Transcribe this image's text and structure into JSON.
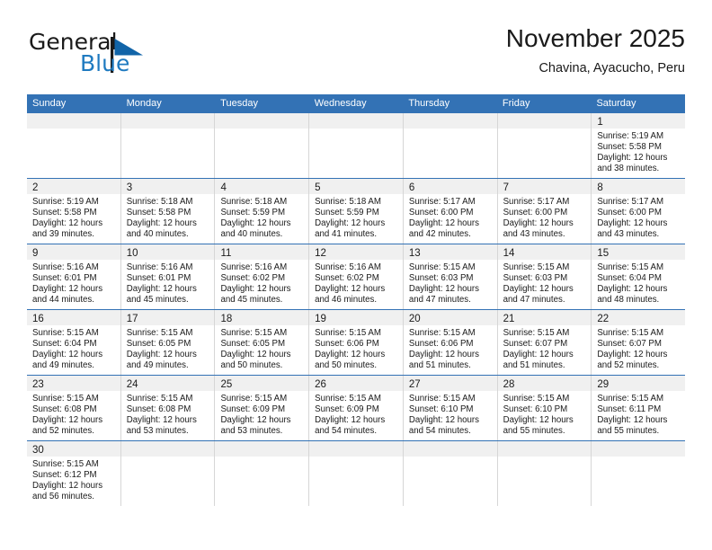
{
  "brand": {
    "name_part1": "General",
    "name_part2": "Blue",
    "logo_icon": "blue-triangle-flag-icon"
  },
  "header": {
    "month_title": "November 2025",
    "location": "Chavina, Ayacucho, Peru"
  },
  "colors": {
    "header_blue": "#3372b5",
    "brand_blue": "#1f7ac0",
    "day_band_gray": "#f0f0f0",
    "cell_divider": "#d6d6d6"
  },
  "weekdays": [
    "Sunday",
    "Monday",
    "Tuesday",
    "Wednesday",
    "Thursday",
    "Friday",
    "Saturday"
  ],
  "weeks": [
    [
      {
        "day": "",
        "lines": []
      },
      {
        "day": "",
        "lines": []
      },
      {
        "day": "",
        "lines": []
      },
      {
        "day": "",
        "lines": []
      },
      {
        "day": "",
        "lines": []
      },
      {
        "day": "",
        "lines": []
      },
      {
        "day": "1",
        "lines": [
          "Sunrise: 5:19 AM",
          "Sunset: 5:58 PM",
          "Daylight: 12 hours",
          "and 38 minutes."
        ]
      }
    ],
    [
      {
        "day": "2",
        "lines": [
          "Sunrise: 5:19 AM",
          "Sunset: 5:58 PM",
          "Daylight: 12 hours",
          "and 39 minutes."
        ]
      },
      {
        "day": "3",
        "lines": [
          "Sunrise: 5:18 AM",
          "Sunset: 5:58 PM",
          "Daylight: 12 hours",
          "and 40 minutes."
        ]
      },
      {
        "day": "4",
        "lines": [
          "Sunrise: 5:18 AM",
          "Sunset: 5:59 PM",
          "Daylight: 12 hours",
          "and 40 minutes."
        ]
      },
      {
        "day": "5",
        "lines": [
          "Sunrise: 5:18 AM",
          "Sunset: 5:59 PM",
          "Daylight: 12 hours",
          "and 41 minutes."
        ]
      },
      {
        "day": "6",
        "lines": [
          "Sunrise: 5:17 AM",
          "Sunset: 6:00 PM",
          "Daylight: 12 hours",
          "and 42 minutes."
        ]
      },
      {
        "day": "7",
        "lines": [
          "Sunrise: 5:17 AM",
          "Sunset: 6:00 PM",
          "Daylight: 12 hours",
          "and 43 minutes."
        ]
      },
      {
        "day": "8",
        "lines": [
          "Sunrise: 5:17 AM",
          "Sunset: 6:00 PM",
          "Daylight: 12 hours",
          "and 43 minutes."
        ]
      }
    ],
    [
      {
        "day": "9",
        "lines": [
          "Sunrise: 5:16 AM",
          "Sunset: 6:01 PM",
          "Daylight: 12 hours",
          "and 44 minutes."
        ]
      },
      {
        "day": "10",
        "lines": [
          "Sunrise: 5:16 AM",
          "Sunset: 6:01 PM",
          "Daylight: 12 hours",
          "and 45 minutes."
        ]
      },
      {
        "day": "11",
        "lines": [
          "Sunrise: 5:16 AM",
          "Sunset: 6:02 PM",
          "Daylight: 12 hours",
          "and 45 minutes."
        ]
      },
      {
        "day": "12",
        "lines": [
          "Sunrise: 5:16 AM",
          "Sunset: 6:02 PM",
          "Daylight: 12 hours",
          "and 46 minutes."
        ]
      },
      {
        "day": "13",
        "lines": [
          "Sunrise: 5:15 AM",
          "Sunset: 6:03 PM",
          "Daylight: 12 hours",
          "and 47 minutes."
        ]
      },
      {
        "day": "14",
        "lines": [
          "Sunrise: 5:15 AM",
          "Sunset: 6:03 PM",
          "Daylight: 12 hours",
          "and 47 minutes."
        ]
      },
      {
        "day": "15",
        "lines": [
          "Sunrise: 5:15 AM",
          "Sunset: 6:04 PM",
          "Daylight: 12 hours",
          "and 48 minutes."
        ]
      }
    ],
    [
      {
        "day": "16",
        "lines": [
          "Sunrise: 5:15 AM",
          "Sunset: 6:04 PM",
          "Daylight: 12 hours",
          "and 49 minutes."
        ]
      },
      {
        "day": "17",
        "lines": [
          "Sunrise: 5:15 AM",
          "Sunset: 6:05 PM",
          "Daylight: 12 hours",
          "and 49 minutes."
        ]
      },
      {
        "day": "18",
        "lines": [
          "Sunrise: 5:15 AM",
          "Sunset: 6:05 PM",
          "Daylight: 12 hours",
          "and 50 minutes."
        ]
      },
      {
        "day": "19",
        "lines": [
          "Sunrise: 5:15 AM",
          "Sunset: 6:06 PM",
          "Daylight: 12 hours",
          "and 50 minutes."
        ]
      },
      {
        "day": "20",
        "lines": [
          "Sunrise: 5:15 AM",
          "Sunset: 6:06 PM",
          "Daylight: 12 hours",
          "and 51 minutes."
        ]
      },
      {
        "day": "21",
        "lines": [
          "Sunrise: 5:15 AM",
          "Sunset: 6:07 PM",
          "Daylight: 12 hours",
          "and 51 minutes."
        ]
      },
      {
        "day": "22",
        "lines": [
          "Sunrise: 5:15 AM",
          "Sunset: 6:07 PM",
          "Daylight: 12 hours",
          "and 52 minutes."
        ]
      }
    ],
    [
      {
        "day": "23",
        "lines": [
          "Sunrise: 5:15 AM",
          "Sunset: 6:08 PM",
          "Daylight: 12 hours",
          "and 52 minutes."
        ]
      },
      {
        "day": "24",
        "lines": [
          "Sunrise: 5:15 AM",
          "Sunset: 6:08 PM",
          "Daylight: 12 hours",
          "and 53 minutes."
        ]
      },
      {
        "day": "25",
        "lines": [
          "Sunrise: 5:15 AM",
          "Sunset: 6:09 PM",
          "Daylight: 12 hours",
          "and 53 minutes."
        ]
      },
      {
        "day": "26",
        "lines": [
          "Sunrise: 5:15 AM",
          "Sunset: 6:09 PM",
          "Daylight: 12 hours",
          "and 54 minutes."
        ]
      },
      {
        "day": "27",
        "lines": [
          "Sunrise: 5:15 AM",
          "Sunset: 6:10 PM",
          "Daylight: 12 hours",
          "and 54 minutes."
        ]
      },
      {
        "day": "28",
        "lines": [
          "Sunrise: 5:15 AM",
          "Sunset: 6:10 PM",
          "Daylight: 12 hours",
          "and 55 minutes."
        ]
      },
      {
        "day": "29",
        "lines": [
          "Sunrise: 5:15 AM",
          "Sunset: 6:11 PM",
          "Daylight: 12 hours",
          "and 55 minutes."
        ]
      }
    ],
    [
      {
        "day": "30",
        "lines": [
          "Sunrise: 5:15 AM",
          "Sunset: 6:12 PM",
          "Daylight: 12 hours",
          "and 56 minutes."
        ]
      },
      {
        "day": "",
        "lines": []
      },
      {
        "day": "",
        "lines": []
      },
      {
        "day": "",
        "lines": []
      },
      {
        "day": "",
        "lines": []
      },
      {
        "day": "",
        "lines": []
      },
      {
        "day": "",
        "lines": []
      }
    ]
  ]
}
